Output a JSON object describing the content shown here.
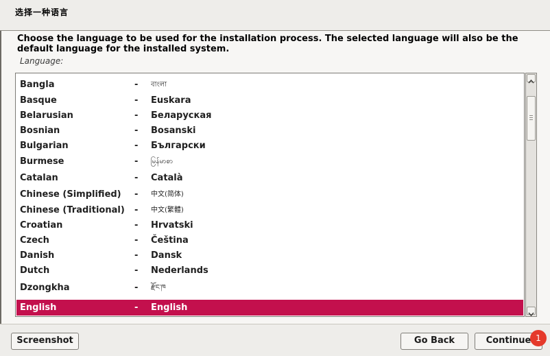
{
  "window": {
    "title": "选择一种语言"
  },
  "prompt": {
    "description": "Choose the language to be used for the installation process. The selected language will also be the default language for the installed system.",
    "list_label": "Language:"
  },
  "languages": [
    {
      "name": "Bangla",
      "native": "বাংলা"
    },
    {
      "name": "Basque",
      "native": "Euskara"
    },
    {
      "name": "Belarusian",
      "native": "Беларуская"
    },
    {
      "name": "Bosnian",
      "native": "Bosanski"
    },
    {
      "name": "Bulgarian",
      "native": "Български"
    },
    {
      "name": "Burmese",
      "native": "မြန်မာစာ"
    },
    {
      "name": "Catalan",
      "native": "Català"
    },
    {
      "name": "Chinese (Simplified)",
      "native": "中文(简体)"
    },
    {
      "name": "Chinese (Traditional)",
      "native": "中文(繁體)"
    },
    {
      "name": "Croatian",
      "native": "Hrvatski"
    },
    {
      "name": "Czech",
      "native": "Čeština"
    },
    {
      "name": "Danish",
      "native": "Dansk"
    },
    {
      "name": "Dutch",
      "native": "Nederlands"
    },
    {
      "name": "Dzongkha",
      "native": "རྫོང་ཁ"
    },
    {
      "name": "English",
      "native": "English",
      "selected": true
    }
  ],
  "separator": "-",
  "buttons": {
    "screenshot": "Screenshot",
    "go_back": "Go Back",
    "continue": "Continue"
  },
  "notification_badge": "1",
  "colors": {
    "selection": "#c3104d",
    "badge": "#e53a2b"
  },
  "icons": {
    "scroll_up": "chevron-up-icon",
    "scroll_down": "chevron-down-icon"
  }
}
